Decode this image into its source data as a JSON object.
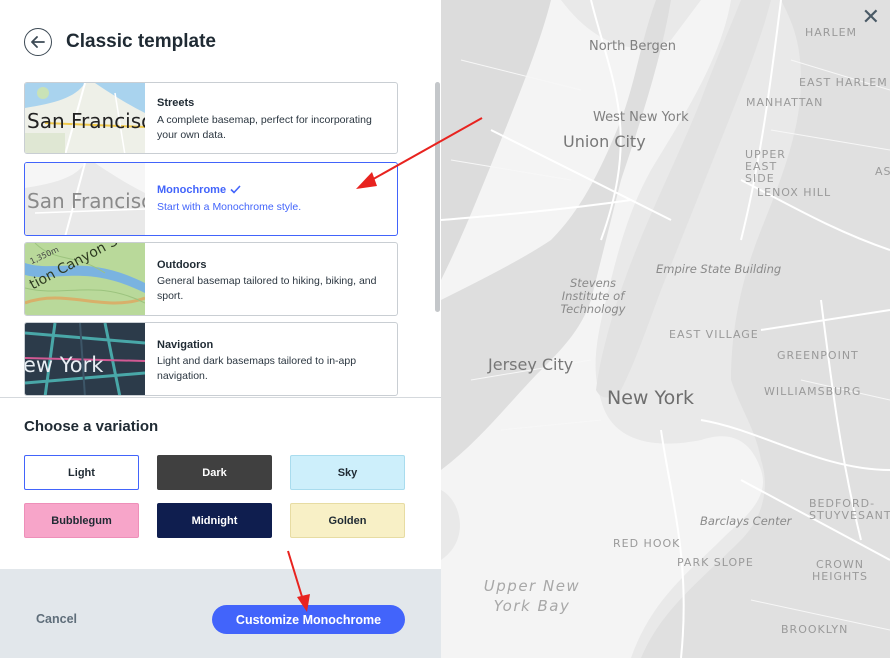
{
  "header": {
    "title": "Classic template",
    "back_icon": "arrow-left-icon"
  },
  "templates": [
    {
      "name": "Streets",
      "description": "A complete basemap, perfect for incorporating your own data.",
      "thumb_text": "San Francisco",
      "selected": false
    },
    {
      "name": "Monochrome",
      "description": "Start with a Monochrome style.",
      "thumb_text": "San Francisco",
      "selected": true
    },
    {
      "name": "Outdoors",
      "description": "General basemap tailored to hiking, biking, and sport.",
      "thumb_text": "tion Canyon Scenic Dr",
      "thumb_subtext": "1,350m",
      "selected": false
    },
    {
      "name": "Navigation",
      "description": "Light and dark basemaps tailored to in-app navigation.",
      "thumb_text": "ew York",
      "selected": false
    }
  ],
  "variation": {
    "heading": "Choose a variation",
    "options": [
      {
        "label": "Light",
        "bg": "#ffffff",
        "fg": "#1f2a33",
        "selected": true
      },
      {
        "label": "Dark",
        "bg": "#404040",
        "fg": "#ffffff",
        "selected": false
      },
      {
        "label": "Sky",
        "bg": "#cdeffb",
        "fg": "#1f2a33",
        "selected": false
      },
      {
        "label": "Bubblegum",
        "bg": "#f7a5c9",
        "fg": "#1f2a33",
        "selected": false
      },
      {
        "label": "Midnight",
        "bg": "#0f1e4f",
        "fg": "#ffffff",
        "selected": false
      },
      {
        "label": "Golden",
        "bg": "#f8f0c6",
        "fg": "#1f2a33",
        "selected": false
      }
    ]
  },
  "footer": {
    "cancel_label": "Cancel",
    "primary_label": "Customize Monochrome"
  },
  "map": {
    "close_icon": "close-icon",
    "labels": [
      "HARLEM",
      "North Bergen",
      "EAST HARLEM",
      "MANHATTAN",
      "West New York",
      "Union City",
      "UPPER EAST SIDE",
      "ASTORIA",
      "LENOX HILL",
      "Empire State Building",
      "Stevens Institute of Technology",
      "EAST VILLAGE",
      "GREENPOINT",
      "Jersey City",
      "New York",
      "WILLIAMSBURG",
      "BEDFORD-STUYVESANT",
      "Barclays Center",
      "RED HOOK",
      "PARK SLOPE",
      "CROWN HEIGHTS",
      "Upper New York Bay",
      "BROOKLYN"
    ]
  },
  "colors": {
    "accent": "#4264fb",
    "annotation_arrow": "#e8231f"
  }
}
